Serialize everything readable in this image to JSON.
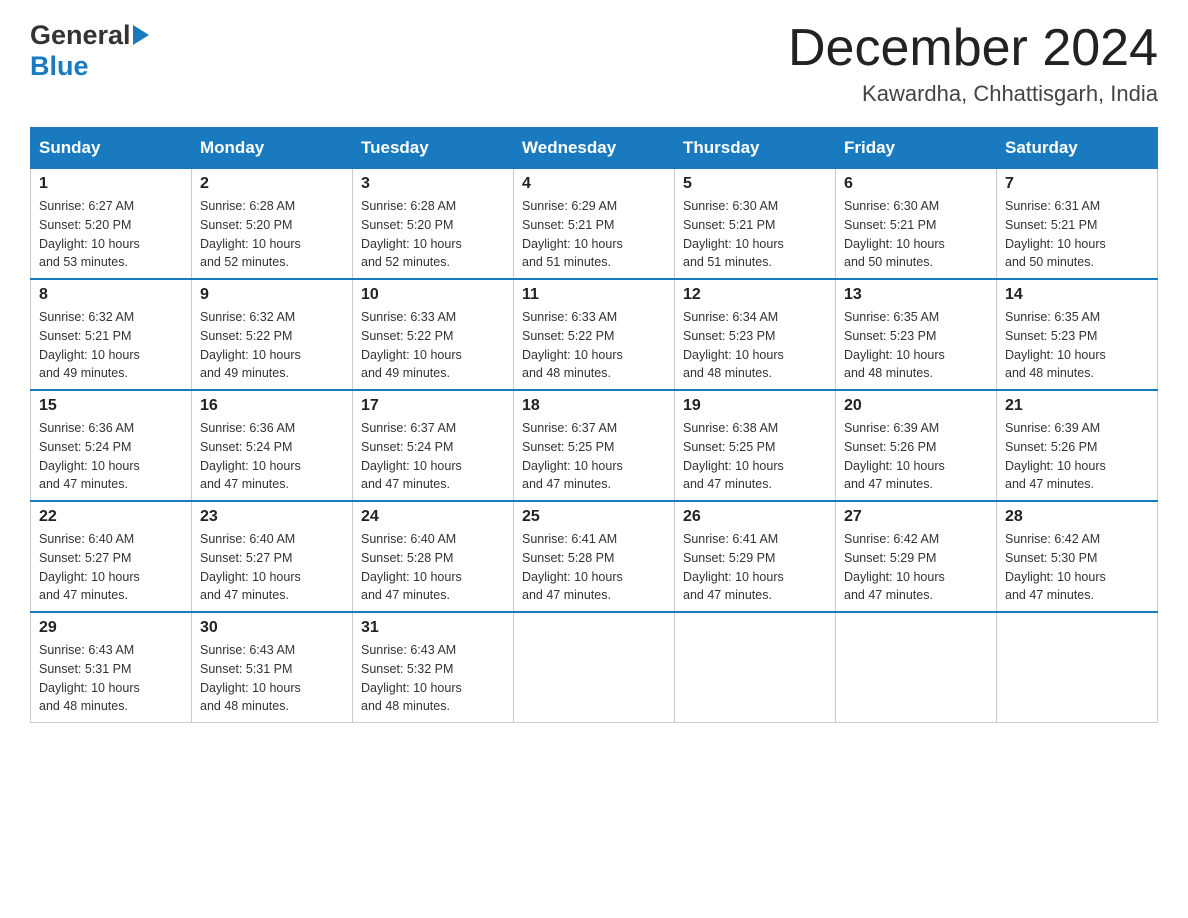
{
  "header": {
    "logo_general": "General",
    "logo_blue": "Blue",
    "month_title": "December 2024",
    "location": "Kawardha, Chhattisgarh, India"
  },
  "days_of_week": [
    "Sunday",
    "Monday",
    "Tuesday",
    "Wednesday",
    "Thursday",
    "Friday",
    "Saturday"
  ],
  "weeks": [
    [
      {
        "day": "1",
        "sunrise": "6:27 AM",
        "sunset": "5:20 PM",
        "daylight": "10 hours and 53 minutes."
      },
      {
        "day": "2",
        "sunrise": "6:28 AM",
        "sunset": "5:20 PM",
        "daylight": "10 hours and 52 minutes."
      },
      {
        "day": "3",
        "sunrise": "6:28 AM",
        "sunset": "5:20 PM",
        "daylight": "10 hours and 52 minutes."
      },
      {
        "day": "4",
        "sunrise": "6:29 AM",
        "sunset": "5:21 PM",
        "daylight": "10 hours and 51 minutes."
      },
      {
        "day": "5",
        "sunrise": "6:30 AM",
        "sunset": "5:21 PM",
        "daylight": "10 hours and 51 minutes."
      },
      {
        "day": "6",
        "sunrise": "6:30 AM",
        "sunset": "5:21 PM",
        "daylight": "10 hours and 50 minutes."
      },
      {
        "day": "7",
        "sunrise": "6:31 AM",
        "sunset": "5:21 PM",
        "daylight": "10 hours and 50 minutes."
      }
    ],
    [
      {
        "day": "8",
        "sunrise": "6:32 AM",
        "sunset": "5:21 PM",
        "daylight": "10 hours and 49 minutes."
      },
      {
        "day": "9",
        "sunrise": "6:32 AM",
        "sunset": "5:22 PM",
        "daylight": "10 hours and 49 minutes."
      },
      {
        "day": "10",
        "sunrise": "6:33 AM",
        "sunset": "5:22 PM",
        "daylight": "10 hours and 49 minutes."
      },
      {
        "day": "11",
        "sunrise": "6:33 AM",
        "sunset": "5:22 PM",
        "daylight": "10 hours and 48 minutes."
      },
      {
        "day": "12",
        "sunrise": "6:34 AM",
        "sunset": "5:23 PM",
        "daylight": "10 hours and 48 minutes."
      },
      {
        "day": "13",
        "sunrise": "6:35 AM",
        "sunset": "5:23 PM",
        "daylight": "10 hours and 48 minutes."
      },
      {
        "day": "14",
        "sunrise": "6:35 AM",
        "sunset": "5:23 PM",
        "daylight": "10 hours and 48 minutes."
      }
    ],
    [
      {
        "day": "15",
        "sunrise": "6:36 AM",
        "sunset": "5:24 PM",
        "daylight": "10 hours and 47 minutes."
      },
      {
        "day": "16",
        "sunrise": "6:36 AM",
        "sunset": "5:24 PM",
        "daylight": "10 hours and 47 minutes."
      },
      {
        "day": "17",
        "sunrise": "6:37 AM",
        "sunset": "5:24 PM",
        "daylight": "10 hours and 47 minutes."
      },
      {
        "day": "18",
        "sunrise": "6:37 AM",
        "sunset": "5:25 PM",
        "daylight": "10 hours and 47 minutes."
      },
      {
        "day": "19",
        "sunrise": "6:38 AM",
        "sunset": "5:25 PM",
        "daylight": "10 hours and 47 minutes."
      },
      {
        "day": "20",
        "sunrise": "6:39 AM",
        "sunset": "5:26 PM",
        "daylight": "10 hours and 47 minutes."
      },
      {
        "day": "21",
        "sunrise": "6:39 AM",
        "sunset": "5:26 PM",
        "daylight": "10 hours and 47 minutes."
      }
    ],
    [
      {
        "day": "22",
        "sunrise": "6:40 AM",
        "sunset": "5:27 PM",
        "daylight": "10 hours and 47 minutes."
      },
      {
        "day": "23",
        "sunrise": "6:40 AM",
        "sunset": "5:27 PM",
        "daylight": "10 hours and 47 minutes."
      },
      {
        "day": "24",
        "sunrise": "6:40 AM",
        "sunset": "5:28 PM",
        "daylight": "10 hours and 47 minutes."
      },
      {
        "day": "25",
        "sunrise": "6:41 AM",
        "sunset": "5:28 PM",
        "daylight": "10 hours and 47 minutes."
      },
      {
        "day": "26",
        "sunrise": "6:41 AM",
        "sunset": "5:29 PM",
        "daylight": "10 hours and 47 minutes."
      },
      {
        "day": "27",
        "sunrise": "6:42 AM",
        "sunset": "5:29 PM",
        "daylight": "10 hours and 47 minutes."
      },
      {
        "day": "28",
        "sunrise": "6:42 AM",
        "sunset": "5:30 PM",
        "daylight": "10 hours and 47 minutes."
      }
    ],
    [
      {
        "day": "29",
        "sunrise": "6:43 AM",
        "sunset": "5:31 PM",
        "daylight": "10 hours and 48 minutes."
      },
      {
        "day": "30",
        "sunrise": "6:43 AM",
        "sunset": "5:31 PM",
        "daylight": "10 hours and 48 minutes."
      },
      {
        "day": "31",
        "sunrise": "6:43 AM",
        "sunset": "5:32 PM",
        "daylight": "10 hours and 48 minutes."
      },
      null,
      null,
      null,
      null
    ]
  ],
  "labels": {
    "sunrise_prefix": "Sunrise: ",
    "sunset_prefix": "Sunset: ",
    "daylight_prefix": "Daylight: "
  }
}
